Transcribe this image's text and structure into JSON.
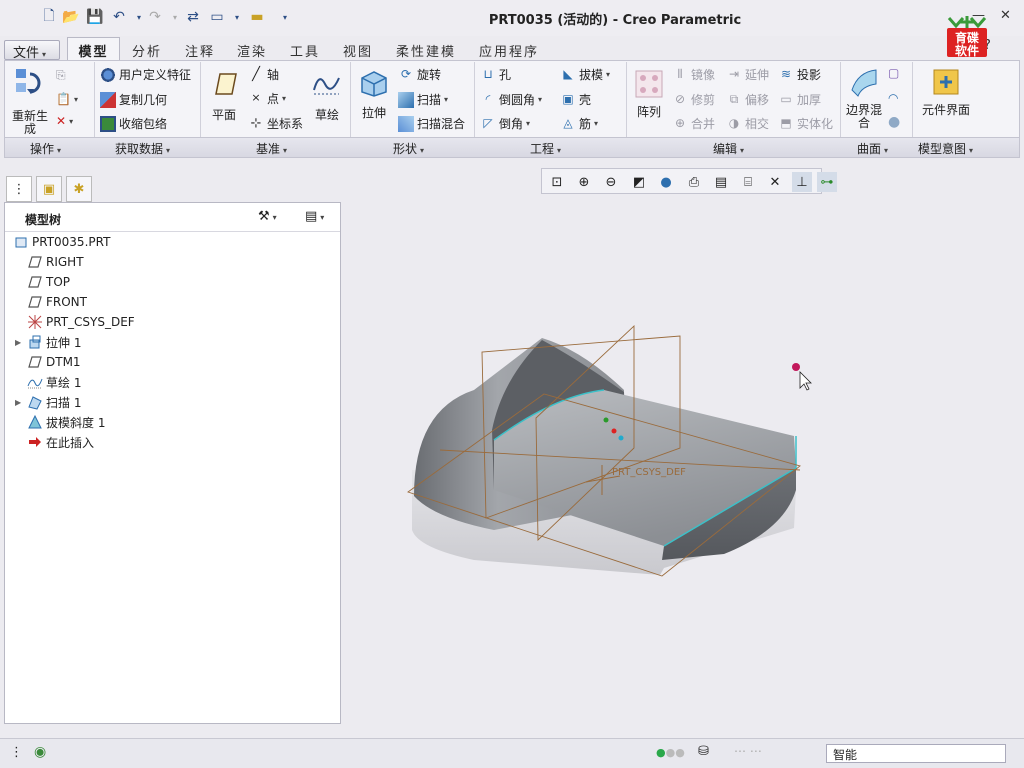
{
  "window": {
    "title": "PRT0035 (活动的) - Creo Parametric"
  },
  "logo_text": "育碟软件",
  "tabs": {
    "file": "文件",
    "items": [
      "模型",
      "分析",
      "注释",
      "渲染",
      "工具",
      "视图",
      "柔性建模",
      "应用程序"
    ]
  },
  "ribbon": {
    "operations": {
      "regen": "重新生成",
      "group": "操作"
    },
    "get_data": {
      "udf": "用户定义特征",
      "copy_geom": "复制几何",
      "shrinkwrap": "收缩包络",
      "group": "获取数据"
    },
    "datum": {
      "plane": "平面",
      "axis": "轴",
      "point": "点",
      "csys": "坐标系",
      "sketch": "草绘",
      "group": "基准"
    },
    "shapes": {
      "extrude": "拉伸",
      "revolve": "旋转",
      "sweep": "扫描",
      "swept_blend": "扫描混合",
      "group": "形状"
    },
    "engineering": {
      "hole": "孔",
      "round": "倒圆角",
      "chamfer": "倒角",
      "draft": "拔模",
      "shell": "壳",
      "rib": "筋",
      "group": "工程"
    },
    "editing": {
      "pattern": "阵列",
      "mirror": "镜像",
      "extend": "延伸",
      "project": "投影",
      "trim": "修剪",
      "offset": "偏移",
      "thicken": "加厚",
      "merge": "合并",
      "intersect": "相交",
      "solidify": "实体化",
      "group": "编辑"
    },
    "surfaces": {
      "boundary_blend": "边界混合",
      "group": "曲面"
    },
    "model_intent": {
      "component_interface": "元件界面",
      "group": "模型意图"
    }
  },
  "model_tree": {
    "title": "模型树",
    "items": [
      {
        "label": "PRT0035.PRT",
        "icon": "part-icon",
        "expandable": false,
        "level": 0
      },
      {
        "label": "RIGHT",
        "icon": "datum-plane-icon",
        "expandable": false,
        "level": 1
      },
      {
        "label": "TOP",
        "icon": "datum-plane-icon",
        "expandable": false,
        "level": 1
      },
      {
        "label": "FRONT",
        "icon": "datum-plane-icon",
        "expandable": false,
        "level": 1
      },
      {
        "label": "PRT_CSYS_DEF",
        "icon": "csys-icon",
        "expandable": false,
        "level": 1
      },
      {
        "label": "拉伸 1",
        "icon": "extrude-icon",
        "expandable": true,
        "level": 1
      },
      {
        "label": "DTM1",
        "icon": "datum-plane-icon",
        "expandable": false,
        "level": 1
      },
      {
        "label": "草绘 1",
        "icon": "sketch-icon",
        "expandable": false,
        "level": 1
      },
      {
        "label": "扫描 1",
        "icon": "sweep-icon",
        "expandable": true,
        "level": 1
      },
      {
        "label": "拔模斜度 1",
        "icon": "draft-icon",
        "expandable": false,
        "level": 1
      },
      {
        "label": "在此插入",
        "icon": "insert-here-icon",
        "expandable": false,
        "level": 1
      }
    ]
  },
  "viewport": {
    "csys_label": "PRT_CSYS_DEF"
  },
  "status_bar": {
    "filter": "智能"
  },
  "colors": {
    "accent": "#2d4f86",
    "ribbon_bg": "#f4f4f8",
    "model_gray": "#8e9196",
    "datum_brown": "#9a6b3c"
  }
}
